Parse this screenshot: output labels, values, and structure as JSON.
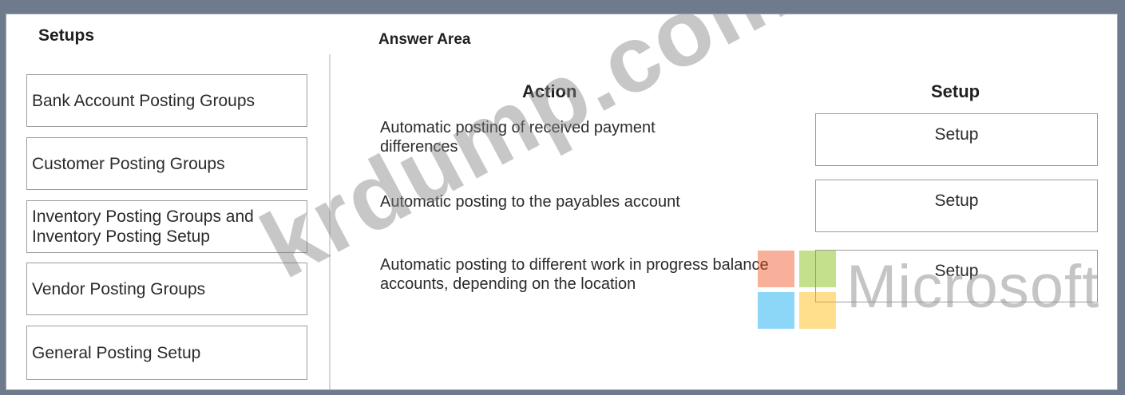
{
  "setups_panel": {
    "title": "Setups",
    "items": [
      "Bank Account Posting Groups",
      "Customer Posting Groups",
      "Inventory Posting Groups and\nInventory Posting Setup",
      "Vendor Posting Groups",
      "General Posting Setup"
    ]
  },
  "answer_area": {
    "title": "Answer Area",
    "action_header": "Action",
    "setup_header": "Setup",
    "rows": [
      {
        "action": "Automatic posting of received payment differences",
        "setup": "Setup"
      },
      {
        "action": "Automatic posting to the payables account",
        "setup": "Setup"
      },
      {
        "action": "Automatic posting to different work in progress balance accounts, depending on the location",
        "setup": "Setup"
      }
    ]
  },
  "watermark": {
    "text": "krdump.com",
    "brand_text": "Microsoft",
    "logo_colors": [
      "#f25022",
      "#7fba00",
      "#00a4ef",
      "#ffb900"
    ]
  }
}
